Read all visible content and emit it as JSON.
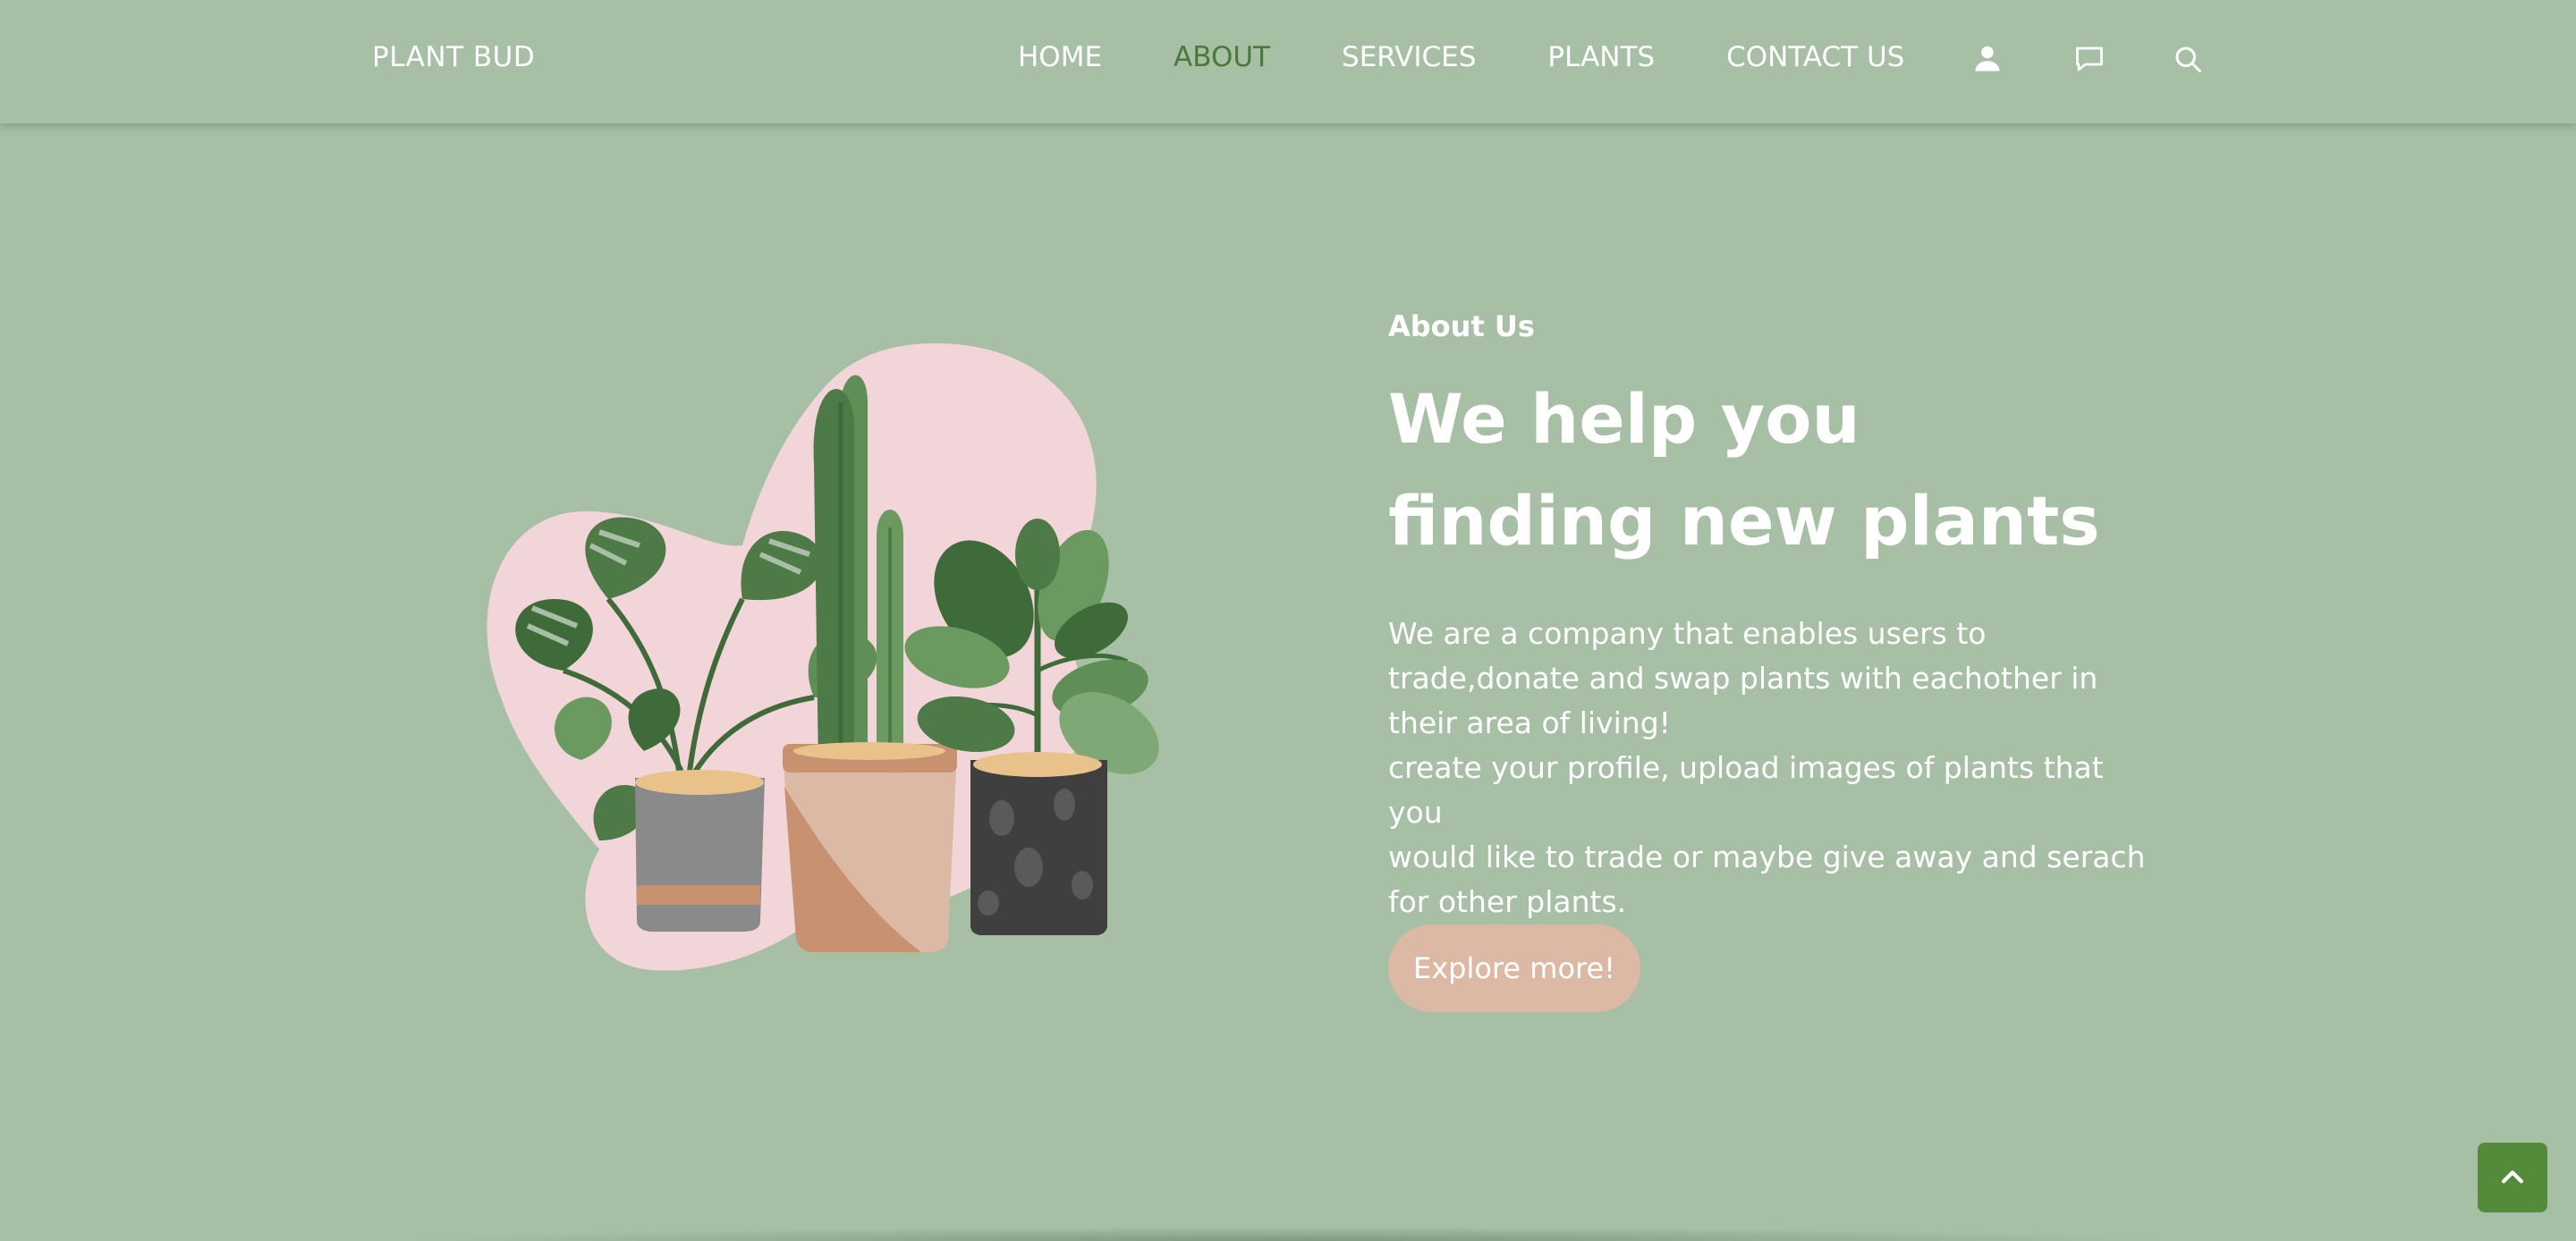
{
  "header": {
    "logo": "PLANT BUD",
    "nav": [
      {
        "label": "HOME",
        "active": false
      },
      {
        "label": "ABOUT",
        "active": true
      },
      {
        "label": "SERVICES",
        "active": false
      },
      {
        "label": "PLANTS",
        "active": false
      },
      {
        "label": "CONTACT US",
        "active": false
      }
    ],
    "icons": [
      "user-icon",
      "chat-icon",
      "search-icon"
    ]
  },
  "about": {
    "label": "About Us",
    "headline_line1": "We help you",
    "headline_line2": "finding new plants",
    "description_lines": [
      "We are a company that enables users to",
      "trade,donate and swap plants with eachother in",
      "their area of living!",
      "create your profile, upload images of plants that you",
      "would like to trade or maybe give away and serach",
      "for other plants."
    ],
    "button_label": "Explore more!"
  },
  "colors": {
    "background": "#a6bfa5",
    "active_nav": "#4a7a3a",
    "button": "#dcb9a4",
    "back_to_top": "#548b3a",
    "blob": "#f2d5d8"
  },
  "back_to_top_icon": "chevron-up-icon"
}
